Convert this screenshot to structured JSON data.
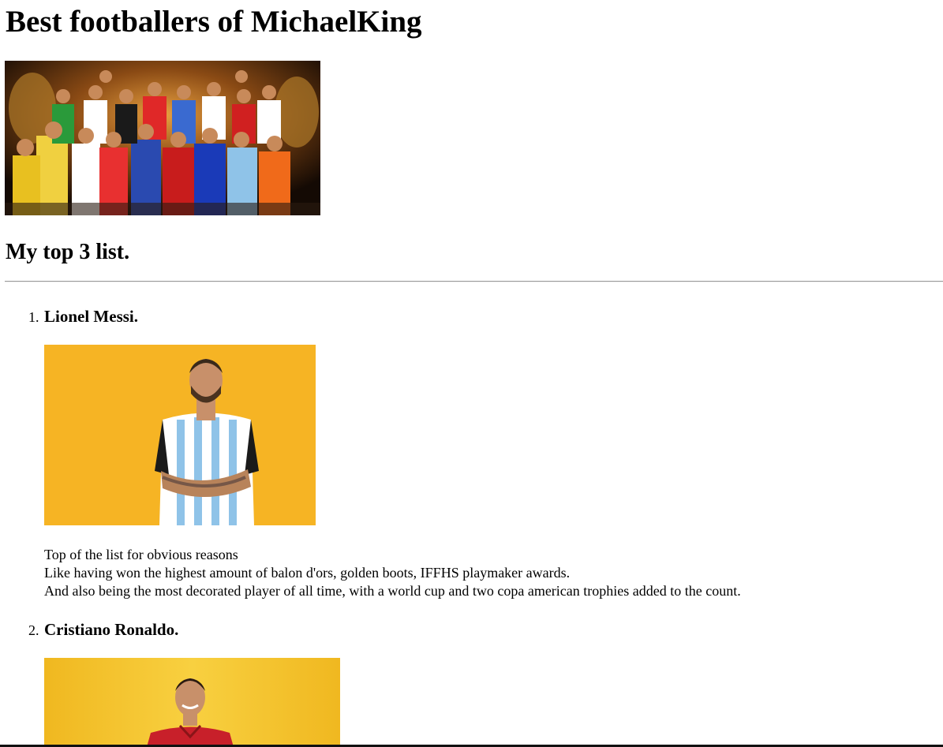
{
  "page": {
    "title": "Best footballers of MichaelKing",
    "subtitle": "My top 3 list."
  },
  "banner": {
    "image": "footballers-collage"
  },
  "list": {
    "items": [
      {
        "number": "1.",
        "name": "Lionel Messi.",
        "photo": "messi-photo",
        "description": [
          "Top of the list for obvious reasons",
          "Like having won the highest amount of balon d'ors, golden boots, IFFHS playmaker awards.",
          "And also being the most decorated player of all time, with a world cup and two copa american trophies added to the count."
        ]
      },
      {
        "number": "2.",
        "name": "Cristiano Ronaldo.",
        "photo": "ronaldo-photo"
      }
    ]
  },
  "colors": {
    "messi_bg": "#f6b424",
    "ronaldo_bg": "#f5c22a",
    "argentina_blue": "#8fc3e8",
    "portugal_red": "#c8202a",
    "divider": "#9a9a9a"
  }
}
